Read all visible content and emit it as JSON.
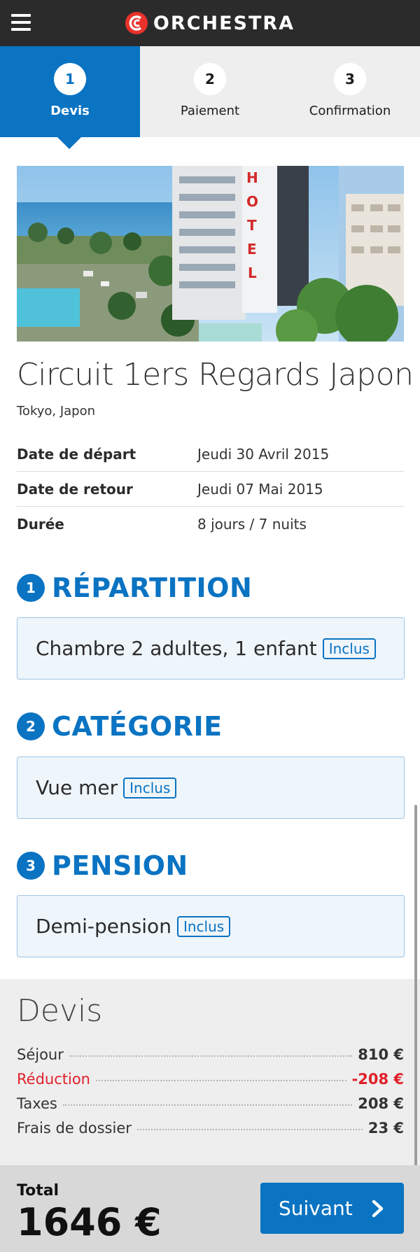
{
  "header": {
    "brand": "ORCHESTRA",
    "menu_icon": "hamburger-menu-icon",
    "logo_icon": "orchestra-logo-icon"
  },
  "steps": [
    {
      "number": "1",
      "label": "Devis",
      "active": true
    },
    {
      "number": "2",
      "label": "Paiement",
      "active": false
    },
    {
      "number": "3",
      "label": "Confirmation",
      "active": false
    }
  ],
  "trip": {
    "title": "Circuit 1ers Regards Japon",
    "location": "Tokyo, Japon",
    "image_icon": "hotel-photo",
    "image_sign": "HOTEL",
    "info": [
      {
        "key": "Date de départ",
        "value": "Jeudi 30 Avril 2015"
      },
      {
        "key": "Date de retour",
        "value": "Jeudi 07 Mai 2015"
      },
      {
        "key": "Durée",
        "value": "8 jours / 7 nuits"
      }
    ]
  },
  "sections": [
    {
      "number": "1",
      "title": "RÉPARTITION",
      "option": "Chambre 2 adultes, 1 enfant",
      "badge": "Inclus"
    },
    {
      "number": "2",
      "title": "CATÉGORIE",
      "option": "Vue mer",
      "badge": "Inclus"
    },
    {
      "number": "3",
      "title": "PENSION",
      "option": "Demi-pension",
      "badge": "Inclus"
    }
  ],
  "devis": {
    "title": "Devis",
    "lines": [
      {
        "label": "Séjour",
        "amount": "810 €",
        "highlight": false
      },
      {
        "label": "Réduction",
        "amount": "-208 €",
        "highlight": true
      },
      {
        "label": "Taxes",
        "amount": "208 €",
        "highlight": false
      },
      {
        "label": "Frais de dossier",
        "amount": "23 €",
        "highlight": false
      }
    ]
  },
  "footer": {
    "total_label": "Total",
    "total_value": "1646 €",
    "next_label": "Suivant",
    "next_icon": "chevron-right-icon"
  },
  "colors": {
    "primary": "#0a73c2",
    "topbar": "#2b2b2b",
    "danger": "#e0202a",
    "logo": "#e8322b"
  }
}
